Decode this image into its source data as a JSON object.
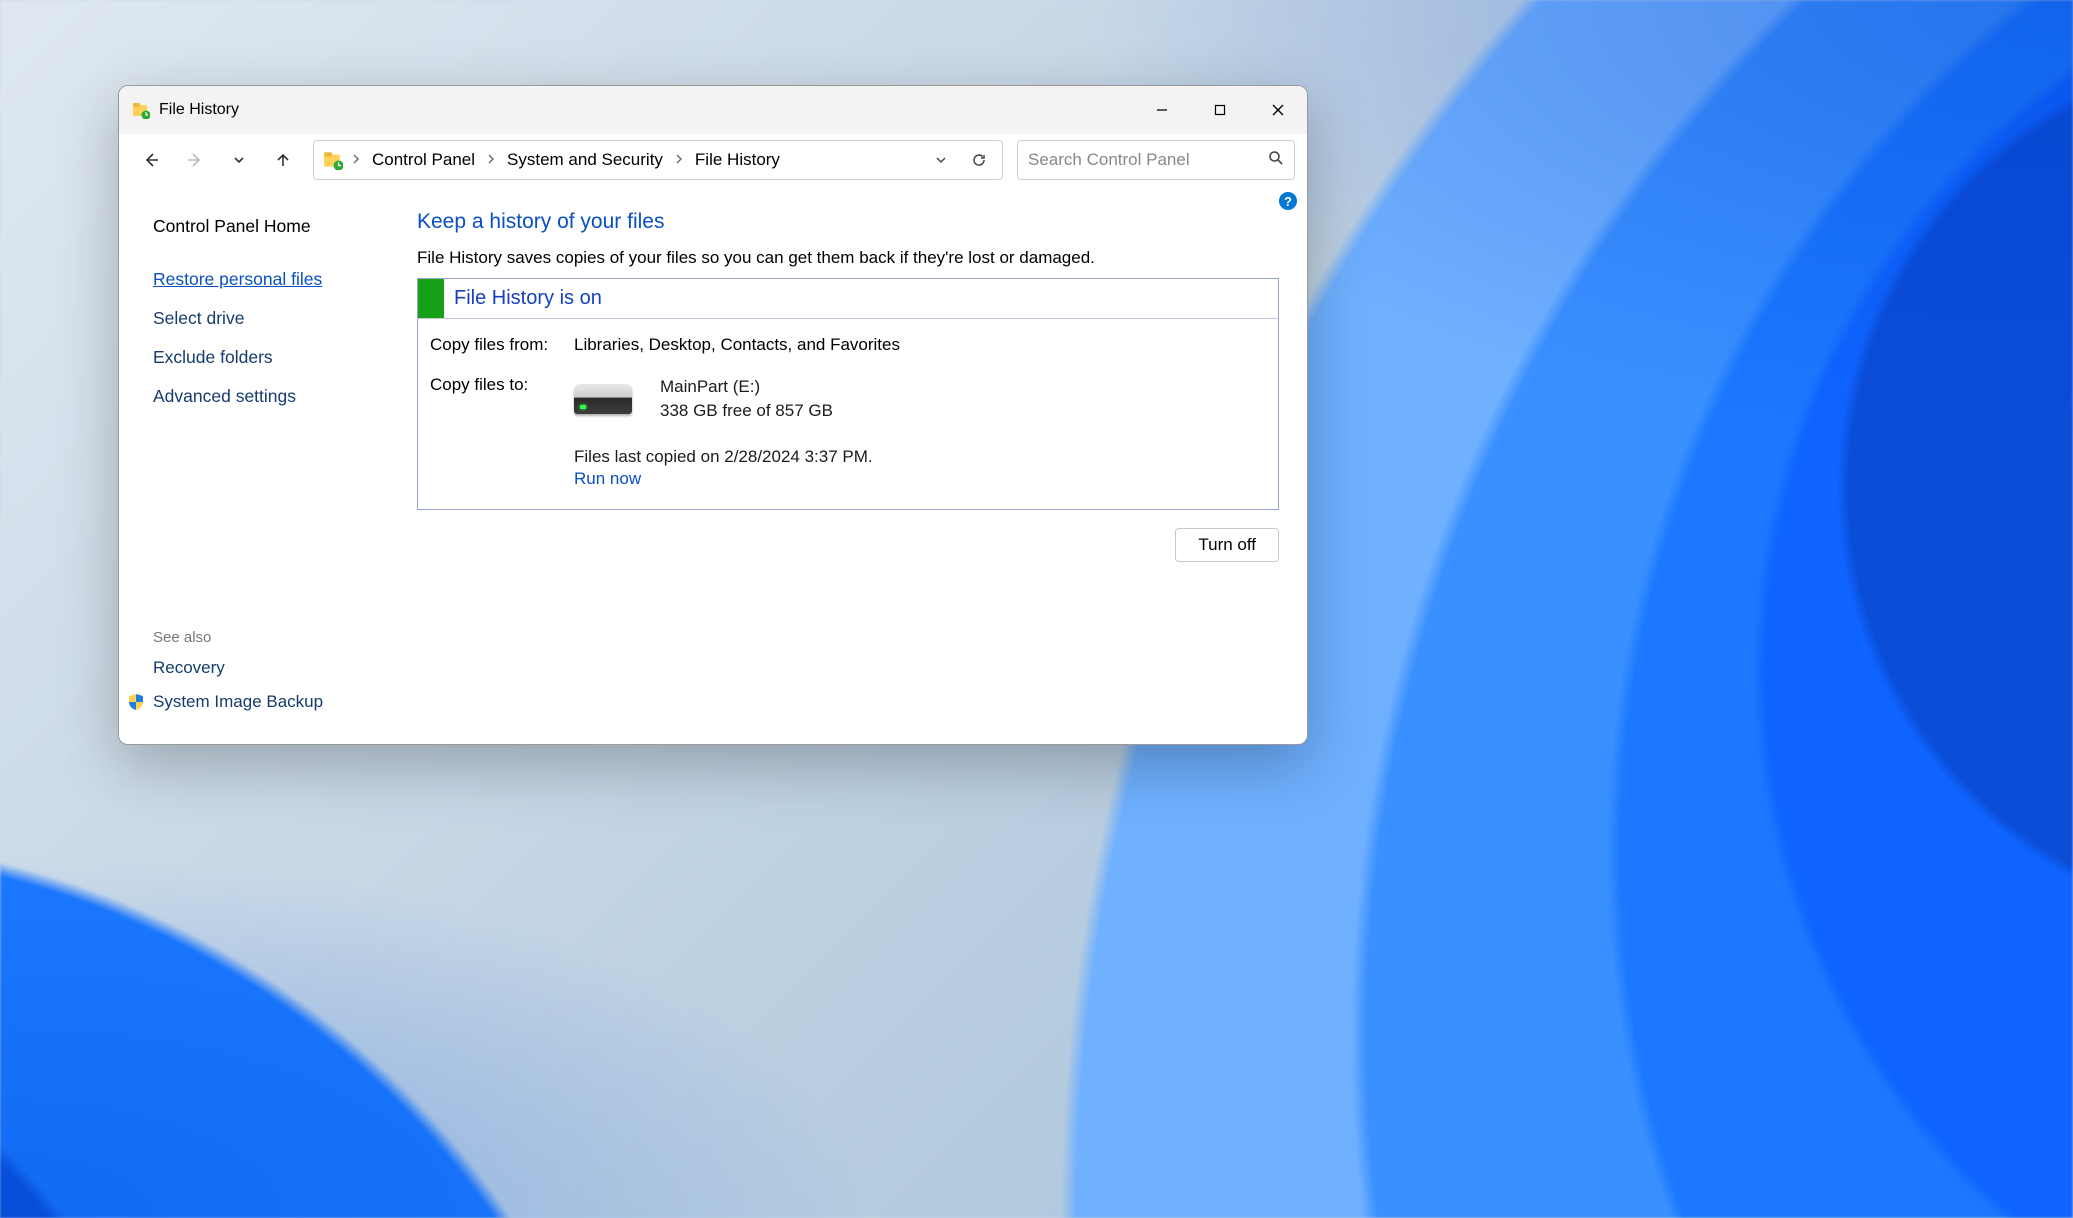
{
  "window": {
    "title": "File History"
  },
  "breadcrumb": {
    "items": [
      "Control Panel",
      "System and Security",
      "File History"
    ]
  },
  "search": {
    "placeholder": "Search Control Panel"
  },
  "sidebar": {
    "home": "Control Panel Home",
    "links": {
      "restore": "Restore personal files",
      "select_drive": "Select drive",
      "exclude": "Exclude folders",
      "advanced": "Advanced settings"
    },
    "see_also_label": "See also",
    "see_also": {
      "recovery": "Recovery",
      "system_image_backup": "System Image Backup"
    }
  },
  "main": {
    "heading": "Keep a history of your files",
    "description": "File History saves copies of your files so you can get them back if they're lost or damaged.",
    "status_title": "File History is on",
    "copy_from_label": "Copy files from:",
    "copy_from_value": "Libraries, Desktop, Contacts, and Favorites",
    "copy_to_label": "Copy files to:",
    "drive_name": "MainPart (E:)",
    "drive_space": "338 GB free of 857 GB",
    "last_copied": "Files last copied on 2/28/2024 3:37 PM.",
    "run_now": "Run now",
    "turn_off": "Turn off"
  }
}
